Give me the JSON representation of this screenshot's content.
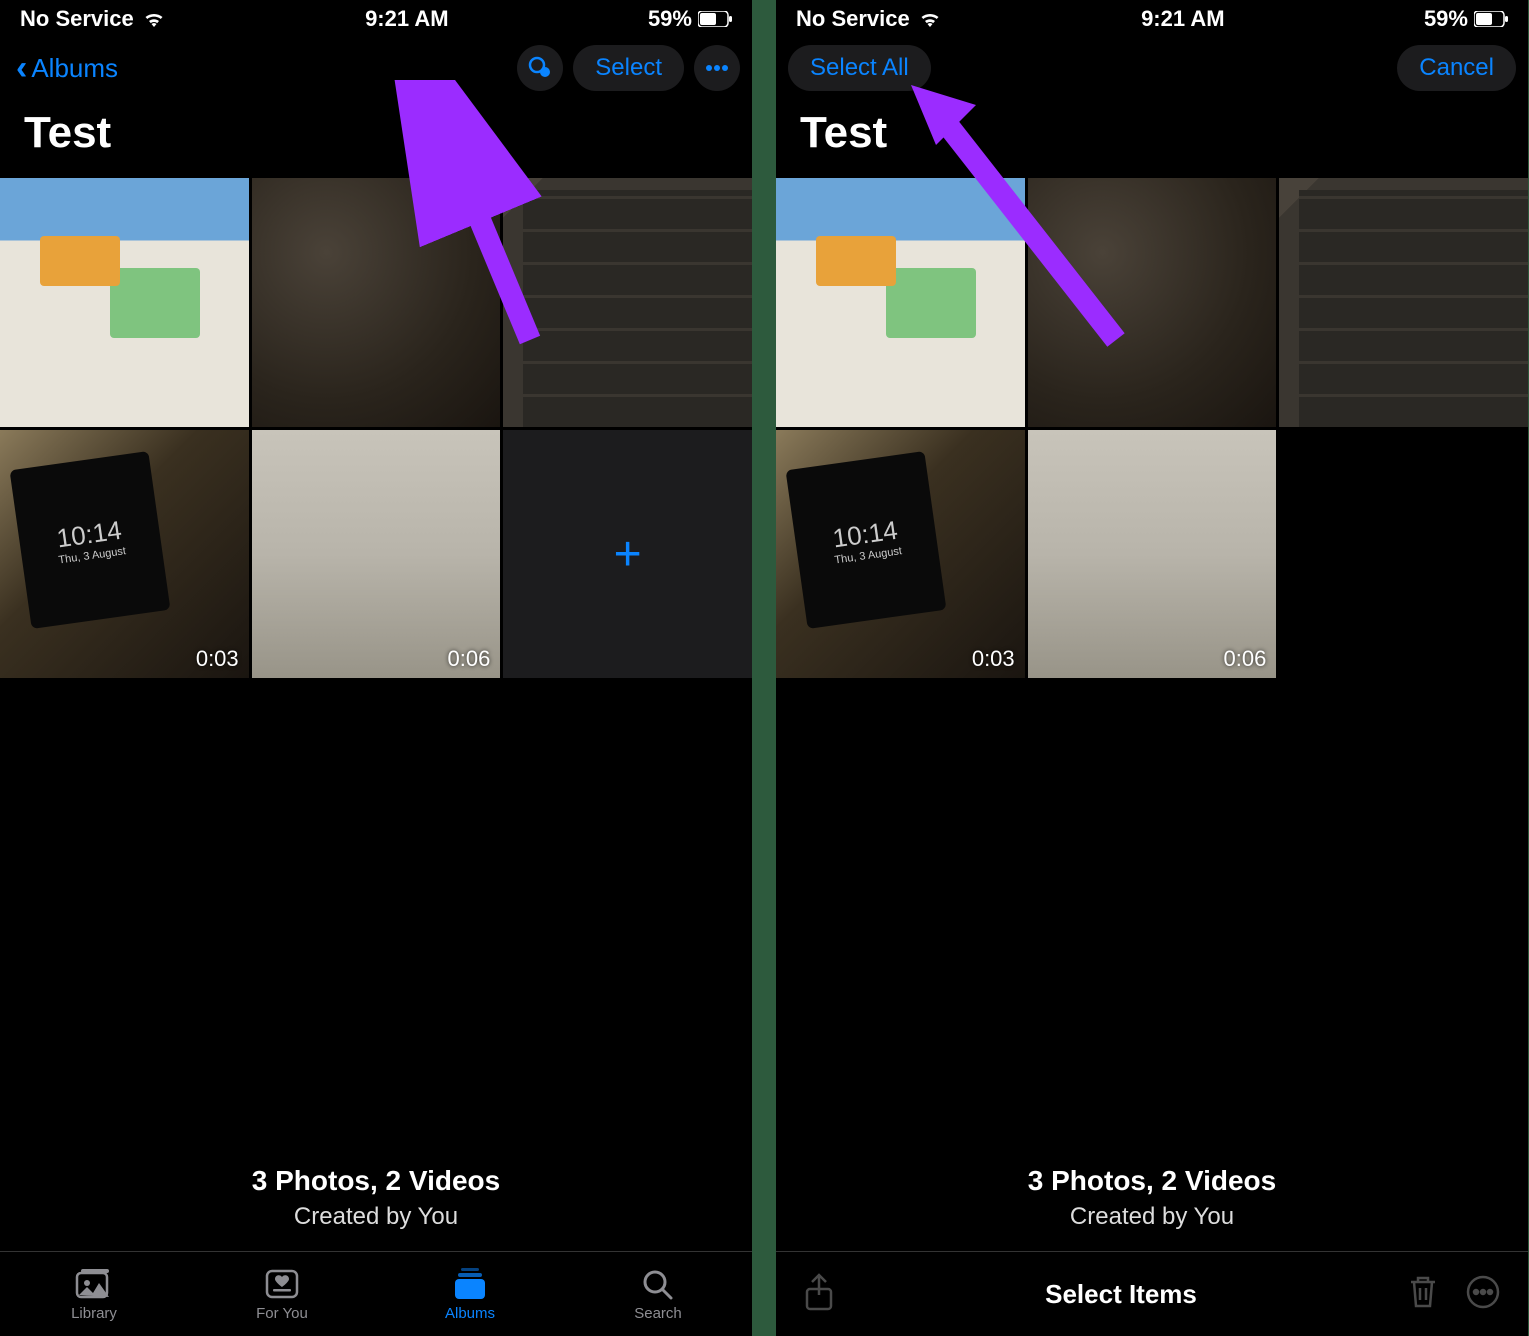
{
  "status": {
    "service": "No Service",
    "time": "9:21 AM",
    "battery_pct": "59%"
  },
  "screen1": {
    "back_label": "Albums",
    "select_label": "Select",
    "title": "Test",
    "thumbs": [
      {
        "name": "photo-1"
      },
      {
        "name": "photo-2"
      },
      {
        "name": "photo-3"
      },
      {
        "name": "video-1",
        "duration": "0:03",
        "phone_time": "10:14",
        "phone_date": "Thu, 3 August"
      },
      {
        "name": "video-2",
        "duration": "0:06"
      }
    ],
    "footer_line1": "3 Photos, 2 Videos",
    "footer_line2": "Created by You",
    "tabs": [
      {
        "label": "Library"
      },
      {
        "label": "For You"
      },
      {
        "label": "Albums"
      },
      {
        "label": "Search"
      }
    ]
  },
  "screen2": {
    "select_all_label": "Select All",
    "cancel_label": "Cancel",
    "title": "Test",
    "thumbs": [
      {
        "name": "photo-1"
      },
      {
        "name": "photo-2"
      },
      {
        "name": "photo-3"
      },
      {
        "name": "video-1",
        "duration": "0:03",
        "phone_time": "10:14",
        "phone_date": "Thu, 3 August"
      },
      {
        "name": "video-2",
        "duration": "0:06"
      }
    ],
    "footer_line1": "3 Photos, 2 Videos",
    "footer_line2": "Created by You",
    "action_title": "Select Items"
  },
  "colors": {
    "accent": "#0a84ff",
    "arrow": "#9b2cff"
  }
}
